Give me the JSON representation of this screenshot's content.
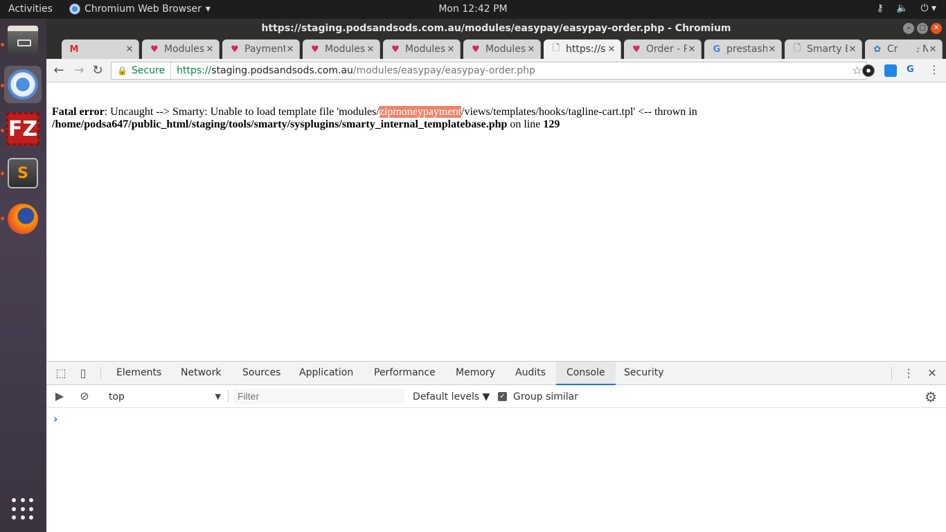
{
  "topbar": {
    "activities": "Activities",
    "app_name": "Chromium Web Browser",
    "app_menu_arrow": "▾",
    "clock": "Mon 12:42 PM",
    "icons": [
      "network-icon",
      "volume-icon",
      "power-icon"
    ]
  },
  "launcher": {
    "items": [
      "files",
      "chromium",
      "filezilla",
      "sublime-text",
      "firefox",
      "show-applications"
    ],
    "filezilla_label": "FZ",
    "sublime_label": "S"
  },
  "window": {
    "title": "https://staging.podsandsods.com.au/modules/easypay/easypay-order.php - Chromium",
    "buttons": {
      "minimize": "–",
      "maximize": "□",
      "close": "✕"
    }
  },
  "tabs": [
    {
      "label": "",
      "favicon": "gmail",
      "favicon_glyph": "M"
    },
    {
      "label": "Modules",
      "favicon": "heart",
      "favicon_glyph": "♥"
    },
    {
      "label": "Payment",
      "favicon": "heart",
      "favicon_glyph": "♥"
    },
    {
      "label": "Modules",
      "favicon": "heart",
      "favicon_glyph": "♥"
    },
    {
      "label": "Modules",
      "favicon": "heart",
      "favicon_glyph": "♥"
    },
    {
      "label": "Modules",
      "favicon": "heart",
      "favicon_glyph": "♥"
    },
    {
      "label": "https://s",
      "favicon": "doc",
      "favicon_glyph": "🗋",
      "active": true
    },
    {
      "label": "Order - P",
      "favicon": "heart",
      "favicon_glyph": "♥"
    },
    {
      "label": "prestash",
      "favicon": "google",
      "favicon_glyph": "G"
    },
    {
      "label": "Smarty E",
      "favicon": "doc",
      "favicon_glyph": "🗋"
    },
    {
      "label": "Create N",
      "favicon": "create",
      "favicon_glyph": "✿"
    }
  ],
  "tab_close_glyph": "✕",
  "toolbar": {
    "back": "←",
    "forward": "→",
    "reload": "↻",
    "secure_label": "Secure",
    "url_scheme": "https://",
    "url_host": "staging.podsandsods.com.au",
    "url_path": "/modules/easypay/easypay-order.php",
    "star": "☆",
    "menu": "⋮",
    "translate_ext": "G"
  },
  "page": {
    "error_label": "Fatal error",
    "error_text_1": ": Uncaught --> Smarty: Unable to load template file 'modules/",
    "error_highlight": "zipmoneypayment",
    "error_text_2": "/views/templates/hooks/tagline-cart.tpl' <-- thrown in",
    "error_file": "/home/podsa647/public_html/staging/tools/smarty/sysplugins/smarty_internal_templatebase.php",
    "error_line_label": " on line ",
    "error_line": "129",
    "highlight_color": "#f0826a"
  },
  "devtools": {
    "tabs": [
      "Elements",
      "Network",
      "Sources",
      "Application",
      "Performance",
      "Memory",
      "Audits",
      "Console",
      "Security"
    ],
    "active_tab": "Console",
    "context": "top",
    "filter_placeholder": "Filter",
    "levels": "Default levels ▼",
    "group_similar": "Group similar",
    "group_similar_checked": true,
    "prompt": "›",
    "menu": "⋮",
    "close": "✕",
    "accent": "#1a73e8"
  }
}
